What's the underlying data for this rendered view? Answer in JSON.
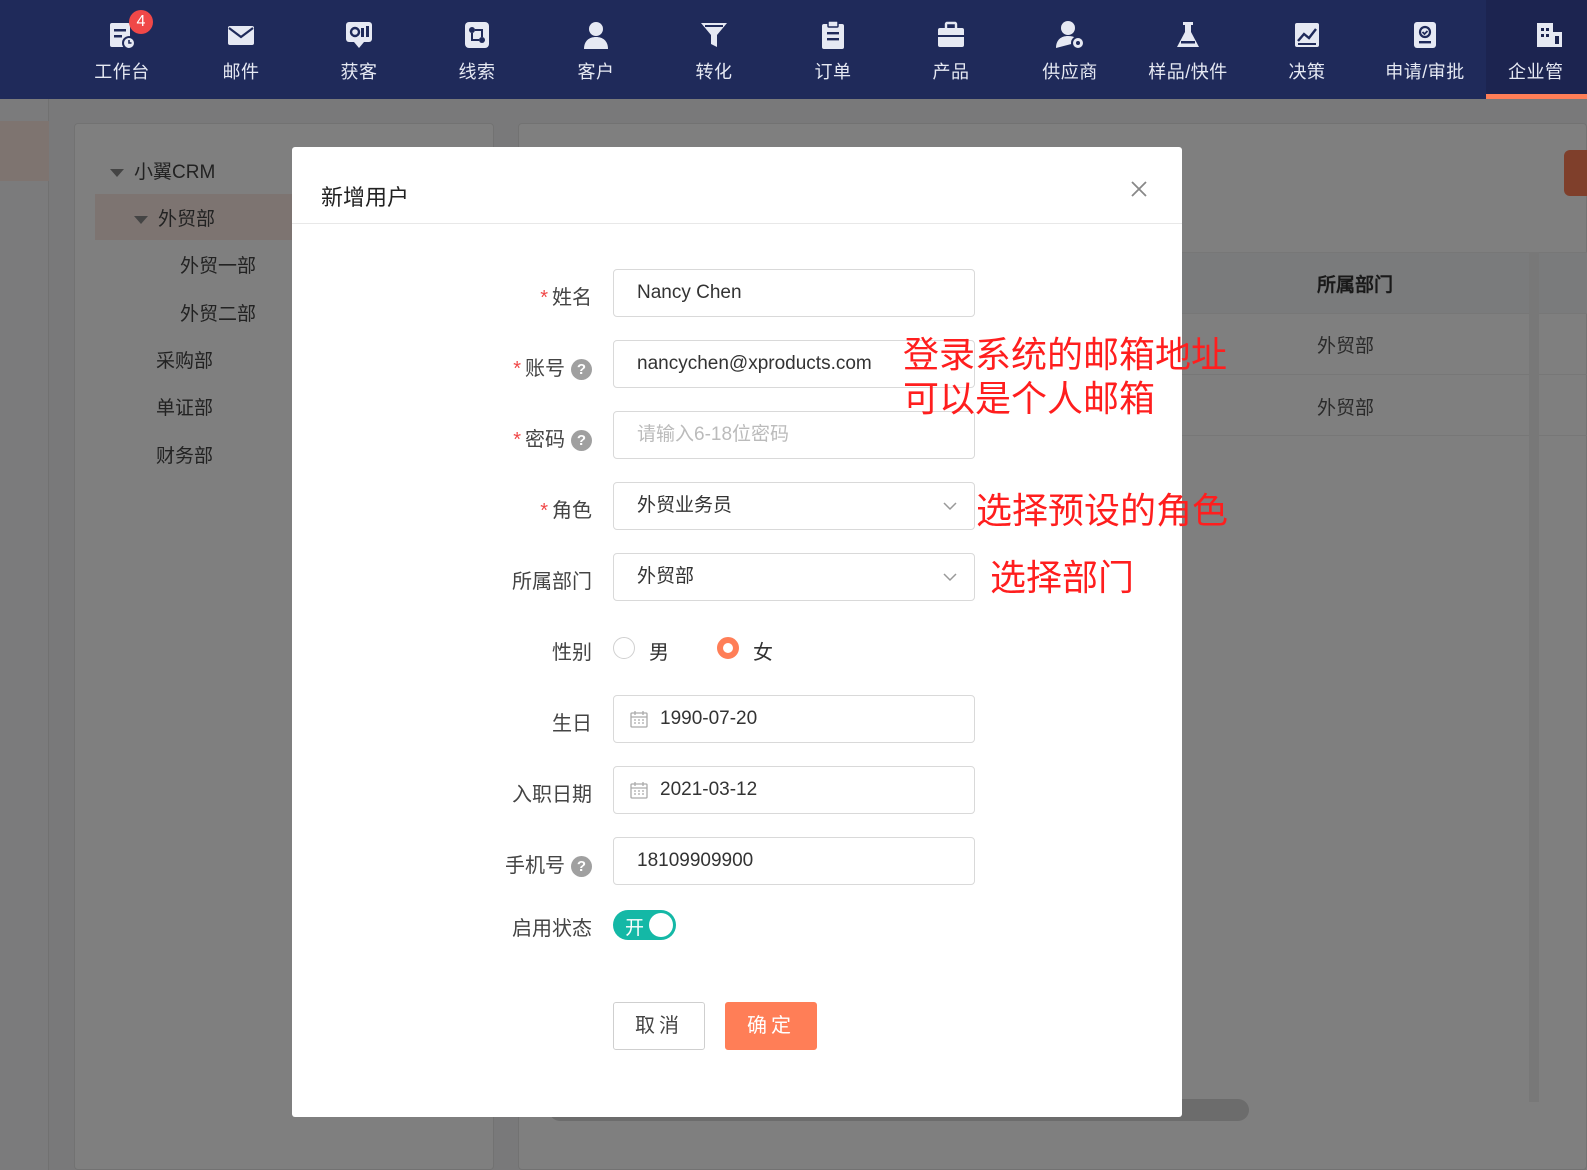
{
  "nav": {
    "badge": "4",
    "items": [
      {
        "label": "工作台"
      },
      {
        "label": "邮件"
      },
      {
        "label": "获客"
      },
      {
        "label": "线索"
      },
      {
        "label": "客户"
      },
      {
        "label": "转化"
      },
      {
        "label": "订单"
      },
      {
        "label": "产品"
      },
      {
        "label": "供应商"
      },
      {
        "label": "样品/快件"
      },
      {
        "label": "决策"
      },
      {
        "label": "申请/审批"
      },
      {
        "label": "企业管"
      }
    ]
  },
  "tree": {
    "root": "小翼CRM",
    "nodes": [
      "外贸部",
      "外贸一部",
      "外贸二部",
      "采购部",
      "单证部",
      "财务部"
    ]
  },
  "table": {
    "header": "所属部门",
    "rows": [
      "外贸部",
      "外贸部"
    ]
  },
  "modal": {
    "title": "新增用户",
    "fields": {
      "name": {
        "label": "姓名",
        "value": "Nancy Chen"
      },
      "account": {
        "label": "账号",
        "value": "nancychen@xproducts.com"
      },
      "password": {
        "label": "密码",
        "placeholder": "请输入6-18位密码"
      },
      "role": {
        "label": "角色",
        "value": "外贸业务员"
      },
      "dept": {
        "label": "所属部门",
        "value": "外贸部"
      },
      "gender": {
        "label": "性别",
        "options": [
          "男",
          "女"
        ],
        "selected": "女"
      },
      "birthday": {
        "label": "生日",
        "value": "1990-07-20"
      },
      "hire_date": {
        "label": "入职日期",
        "value": "2021-03-12"
      },
      "phone": {
        "label": "手机号",
        "value": "18109909900"
      },
      "status": {
        "label": "启用状态",
        "switch_text": "开"
      }
    },
    "cancel_label": "取消",
    "ok_label": "确定"
  },
  "annotations": {
    "account_line1": "登录系统的邮箱地址",
    "account_line2": "可以是个人邮箱",
    "role": "选择预设的角色",
    "dept": "选择部门"
  },
  "colors": {
    "nav_bg": "#1f2a5a",
    "accent": "#ff7e57",
    "switch_on": "#14b8a6",
    "annotation": "#ff1e1e"
  }
}
